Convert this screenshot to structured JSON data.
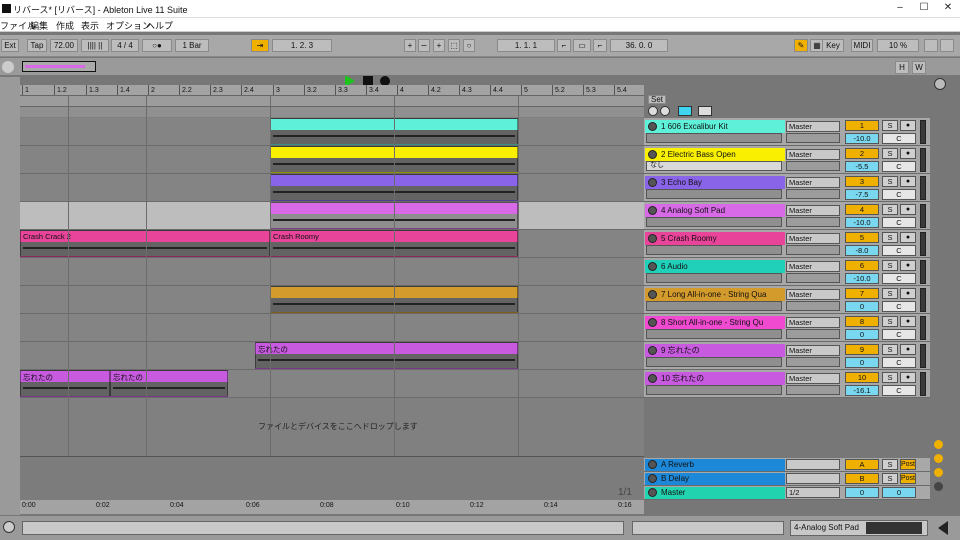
{
  "window": {
    "title": "リバース*  [リバース] - Ableton Live 11 Suite",
    "controls": [
      "–",
      "☐",
      "✕"
    ]
  },
  "menu": [
    "ファイル",
    "編集",
    "作成",
    "表示",
    "オプション",
    "ヘルプ"
  ],
  "control_bar": {
    "ext": "Ext",
    "tap": "Tap",
    "tempo": "72.00",
    "sig": "4 / 4",
    "metro": "○●",
    "quant": "1 Bar",
    "position": "1.   2.   3",
    "loop_start": "1.   1.   1",
    "loop_len": "36.   0.   0",
    "key": "Key",
    "midi": "MIDI",
    "cpu": "10 %",
    "accent": "#f0b000"
  },
  "overview": {
    "h": "H",
    "w": "W"
  },
  "ruler": {
    "labels": [
      "1",
      "1.2",
      "1.3",
      "1.4",
      "2",
      "2.2",
      "2.3",
      "2.4",
      "3",
      "3.2",
      "3.3",
      "3.4",
      "4",
      "4.2",
      "4.3",
      "4.4",
      "5",
      "5.2",
      "5.3",
      "5.4"
    ]
  },
  "time_ruler": {
    "labels": [
      "0:00",
      "0:02",
      "0:04",
      "0:06",
      "0:08",
      "0:10",
      "0:12",
      "0:14",
      "0:16"
    ],
    "page": "1/1"
  },
  "set_label": "Set",
  "clips": [
    {
      "lane": 0,
      "name": "",
      "color": "#5ef0d8"
    },
    {
      "lane": 1,
      "name": "",
      "color": "#f8f000"
    },
    {
      "lane": 2,
      "name": "",
      "color": "#8a64e8"
    },
    {
      "lane": 3,
      "name": "",
      "color": "#d86ae8"
    },
    {
      "lane": 4,
      "name": "Crash Crack 2",
      "color": "#e8449a"
    },
    {
      "lane": 4,
      "name": "Crash Roomy",
      "color": "#e8449a"
    },
    {
      "lane": 6,
      "name": "",
      "color": "#d39a2c"
    },
    {
      "lane": 8,
      "name": "忘れたの",
      "color": "#c85ae0"
    },
    {
      "lane": 9,
      "name": "忘れたの",
      "color": "#c85ae0"
    },
    {
      "lane": 9,
      "name": "忘れたの",
      "color": "#c85ae0"
    }
  ],
  "drop_text": "ファイルとデバイスをここへドロップします",
  "tracks": [
    {
      "name": "1 606 Excalibur Kit",
      "color": "#5ef0d8",
      "route": "Master",
      "num": "1",
      "vol": "-10.0",
      "pan": "C"
    },
    {
      "name": "2 Electric Bass Open",
      "color": "#f8f000",
      "route": "Master",
      "num": "2",
      "vol": "-5.5",
      "pan": "C",
      "sub": "なし"
    },
    {
      "name": "3 Echo Bay",
      "color": "#8a64e8",
      "route": "Master",
      "num": "3",
      "vol": "-7.5",
      "pan": "C"
    },
    {
      "name": "4 Analog Soft Pad",
      "color": "#d86ae8",
      "route": "Master",
      "num": "4",
      "vol": "-10.0",
      "pan": "C"
    },
    {
      "name": "5 Crash Roomy",
      "color": "#e8449a",
      "route": "Master",
      "num": "5",
      "vol": "-8.0",
      "pan": "C"
    },
    {
      "name": "6 Audio",
      "color": "#20d0b8",
      "route": "Master",
      "num": "6",
      "vol": "-10.0",
      "pan": "C"
    },
    {
      "name": "7 Long All-in-one - String Qua",
      "color": "#d39a2c",
      "route": "Master",
      "num": "7",
      "vol": "0",
      "pan": "C"
    },
    {
      "name": "8 Short All-in-one - String Qu",
      "color": "#f04ad0",
      "route": "Master",
      "num": "8",
      "vol": "0",
      "pan": "C"
    },
    {
      "name": "9 忘れたの",
      "color": "#c85ae0",
      "route": "Master",
      "num": "9",
      "vol": "0",
      "pan": "C"
    },
    {
      "name": "10 忘れたの",
      "color": "#c85ae0",
      "route": "Master",
      "num": "10",
      "vol": "-16.1",
      "pan": "C"
    }
  ],
  "returns": [
    {
      "name": "A Reverb",
      "color": "#1e88d8",
      "num": "A",
      "post": "Post"
    },
    {
      "name": "B Delay",
      "color": "#1e88d8",
      "num": "B",
      "post": "Post"
    },
    {
      "name": "Master",
      "color": "#22d3b0",
      "route": "1/2",
      "vol": "0",
      "vol2": "0"
    }
  ],
  "bottom": {
    "device": "4-Analog Soft Pad"
  },
  "s_label": "S"
}
